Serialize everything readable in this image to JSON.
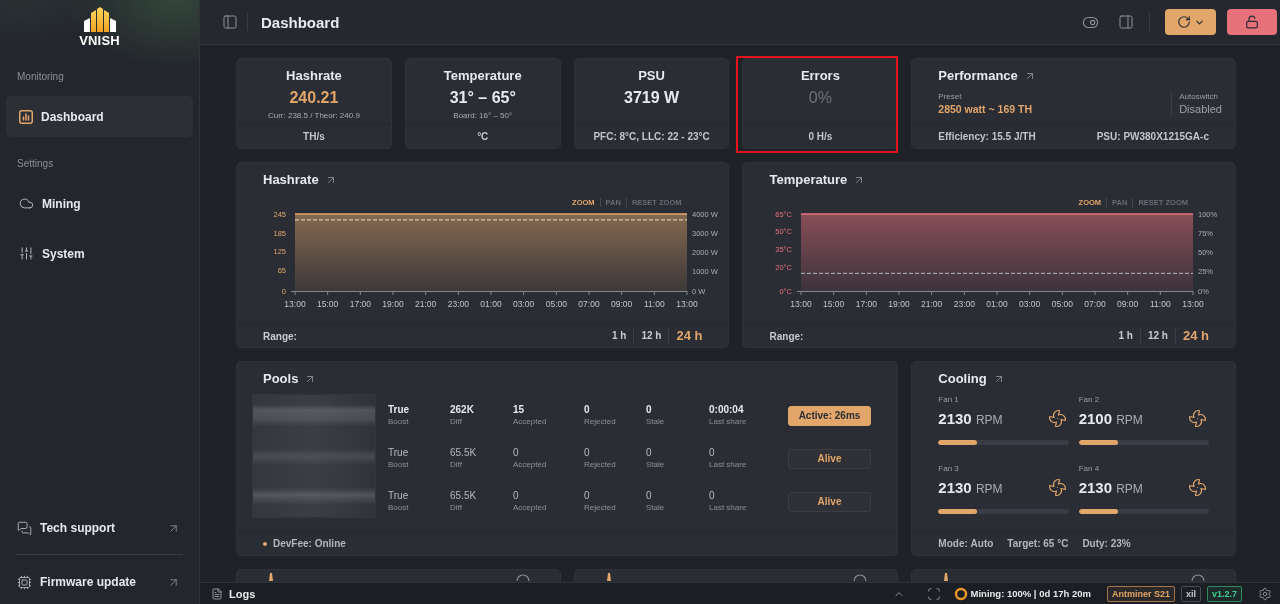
{
  "sidebar": {
    "logo": "VNISH",
    "sections": [
      {
        "title": "Monitoring",
        "items": [
          {
            "label": "Dashboard",
            "selected": true
          }
        ]
      },
      {
        "title": "Settings",
        "items": [
          {
            "label": "Mining",
            "selected": false
          },
          {
            "label": "System",
            "selected": false
          }
        ]
      }
    ],
    "links": [
      "Tech support",
      "Firmware update"
    ]
  },
  "header": {
    "title": "Dashboard"
  },
  "stats": [
    {
      "title": "Hashrate",
      "value": "240.21",
      "accent": true,
      "muted": false,
      "sub": "Curr: 238.5 / Theor: 240.9",
      "footer": "TH/s",
      "highlighted": false
    },
    {
      "title": "Temperature",
      "value": "31° – 65°",
      "accent": false,
      "muted": false,
      "sub": "Board: 16° – 50°",
      "footer": "°C",
      "highlighted": false
    },
    {
      "title": "PSU",
      "value": "3719 W",
      "accent": false,
      "muted": false,
      "footer": "PFC: 8°C, LLC: 22 - 23°C",
      "highlighted": false
    },
    {
      "title": "Errors",
      "value": "0%",
      "accent": false,
      "muted": true,
      "footer": "0 H/s",
      "highlighted": true
    }
  ],
  "performance": {
    "title": "Performance",
    "preset_label": "Preset",
    "preset": "2850 watt ~ 169 TH",
    "autoswitch_label": "Autoswitch",
    "autoswitch": "Disabled",
    "footer": [
      "Efficiency: **15.5 J/TH**",
      "PSU: **PW380X1215GA-c**"
    ]
  },
  "charts": [
    {
      "controls": [
        {
          "label": "ZOOM",
          "selected": true
        },
        {
          "label": "PAN",
          "selected": false
        },
        {
          "label": "RESET ZOOM",
          "selected": false
        }
      ],
      "range_label": "Range:",
      "ranges": [
        {
          "label": "1 h",
          "selected": false
        },
        {
          "label": "12 h",
          "selected": false
        },
        {
          "label": "24 h",
          "selected": true
        }
      ],
      "chart_data": {
        "type": "area",
        "title": "Hashrate",
        "categories": [
          "13:00",
          "15:00",
          "17:00",
          "19:00",
          "21:00",
          "23:00",
          "01:00",
          "03:00",
          "05:00",
          "07:00",
          "09:00",
          "11:00",
          "13:00"
        ],
        "ylim": [
          0,
          245
        ],
        "yticks": [
          0,
          65,
          125,
          185,
          245
        ],
        "y2lim": [
          0,
          4000
        ],
        "y2ticks": [
          {
            "value": 0,
            "label": "0 W"
          },
          {
            "value": 1000,
            "label": "1000 W"
          },
          {
            "value": 2000,
            "label": "2000 W"
          },
          {
            "value": 3000,
            "label": "3000 W"
          },
          {
            "value": 4000,
            "label": "4000 W"
          }
        ],
        "series": [
          {
            "color": "#e2a66b",
            "values": [
              245,
              245,
              245,
              245,
              245,
              245,
              245,
              245,
              245,
              245,
              245,
              245,
              245
            ]
          }
        ],
        "ref_lines": [
          {
            "value": 3700,
            "axis": "y2",
            "color": "#d6c6a6"
          }
        ]
      }
    },
    {
      "controls": [
        {
          "label": "ZOOM",
          "selected": true
        },
        {
          "label": "PAN",
          "selected": false
        },
        {
          "label": "RESET ZOOM",
          "selected": false
        }
      ],
      "range_label": "Range:",
      "ranges": [
        {
          "label": "1 h",
          "selected": false
        },
        {
          "label": "12 h",
          "selected": false
        },
        {
          "label": "24 h",
          "selected": true
        }
      ],
      "chart_data": {
        "type": "area",
        "title": "Temperature",
        "categories": [
          "13:00",
          "15:00",
          "17:00",
          "19:00",
          "21:00",
          "23:00",
          "01:00",
          "03:00",
          "05:00",
          "07:00",
          "09:00",
          "11:00",
          "13:00"
        ],
        "ylim": [
          0,
          65
        ],
        "yticks": [
          {
            "value": 0,
            "label": "0°C"
          },
          {
            "value": 20,
            "label": "20°C"
          },
          {
            "value": 35,
            "label": "35°C"
          },
          {
            "value": 50,
            "label": "50°C"
          },
          {
            "value": 65,
            "label": "65°C"
          }
        ],
        "y2lim": [
          0,
          100
        ],
        "y2ticks": [
          {
            "value": 0,
            "label": "0%"
          },
          {
            "value": 25,
            "label": "25%"
          },
          {
            "value": 50,
            "label": "50%"
          },
          {
            "value": 75,
            "label": "75%"
          },
          {
            "value": 100,
            "label": "100%"
          }
        ],
        "series": [
          {
            "color": "#e8707c",
            "values": [
              65,
              65,
              65,
              65,
              65,
              65,
              65,
              65,
              65,
              65,
              65,
              65,
              65
            ]
          }
        ],
        "ref_lines": [
          {
            "value": 23,
            "axis": "y2",
            "color": "#9fa2a9"
          }
        ]
      }
    }
  ],
  "pools": {
    "title": "Pools",
    "rows": [
      {
        "active": true,
        "status": "Active: 26ms",
        "cells": [
          {
            "value": "True",
            "label": "Boost"
          },
          {
            "value": "262K",
            "label": "Diff"
          },
          {
            "value": "15",
            "label": "Accepted"
          },
          {
            "value": "0",
            "label": "Rejected"
          },
          {
            "value": "0",
            "label": "Stale"
          },
          {
            "value": "0:00:04",
            "label": "Last share"
          }
        ]
      },
      {
        "active": false,
        "status": "Alive",
        "cells": [
          {
            "value": "True",
            "label": "Boost"
          },
          {
            "value": "65.5K",
            "label": "Diff"
          },
          {
            "value": "0",
            "label": "Accepted"
          },
          {
            "value": "0",
            "label": "Rejected"
          },
          {
            "value": "0",
            "label": "Stale"
          },
          {
            "value": "0",
            "label": "Last share"
          }
        ]
      },
      {
        "active": false,
        "status": "Alive",
        "cells": [
          {
            "value": "True",
            "label": "Boost"
          },
          {
            "value": "65.5K",
            "label": "Diff"
          },
          {
            "value": "0",
            "label": "Accepted"
          },
          {
            "value": "0",
            "label": "Rejected"
          },
          {
            "value": "0",
            "label": "Stale"
          },
          {
            "value": "0",
            "label": "Last share"
          }
        ]
      }
    ],
    "footer": "DevFee: **Online**"
  },
  "cooling": {
    "title": "Cooling",
    "fans": [
      {
        "label": "Fan 1",
        "value": "2130",
        "unit": "RPM",
        "level": 0.3
      },
      {
        "label": "Fan 2",
        "value": "2100",
        "unit": "RPM",
        "level": 0.3
      },
      {
        "label": "Fan 3",
        "value": "2130",
        "unit": "RPM",
        "level": 0.3
      },
      {
        "label": "Fan 4",
        "value": "2130",
        "unit": "RPM",
        "level": 0.3
      }
    ],
    "footer": [
      "Mode: **Auto**",
      "Target: **65 °C**",
      "Duty: **23%**"
    ]
  },
  "status_bar": {
    "logs": "Logs",
    "mining": "Mining: 100% | 0d 17h 20m",
    "badges": [
      {
        "label": "Antminer S21",
        "kind": "model"
      },
      {
        "label": "xil",
        "kind": "tag"
      },
      {
        "label": "v1.2.7",
        "kind": "version"
      }
    ]
  }
}
